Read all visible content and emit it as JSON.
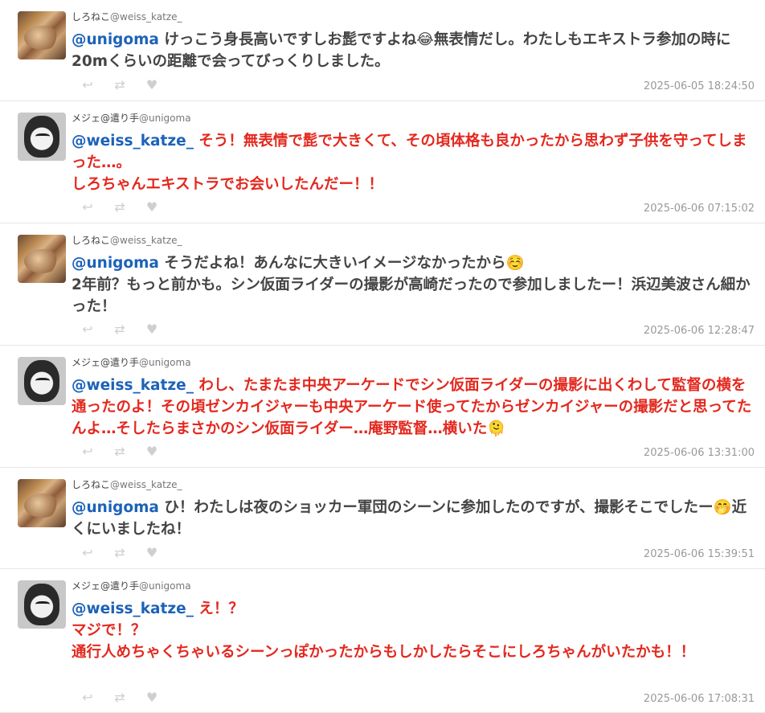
{
  "tweets": [
    {
      "author": "しろねこ",
      "handle": "@weiss_katze_",
      "avatar": "cat-photo-avatar",
      "mention": "@unigoma",
      "text": " けっこう身長高いですしお髭ですよね😂無表情だし。わたしもエキストラ参加の時に20mくらいの距離で会ってびっくりしました。",
      "timestamp": "2025-06-05 18:24:50",
      "color": "#444444"
    },
    {
      "author": "メジェ@遣り手",
      "handle": "@unigoma",
      "avatar": "sketch-face-avatar",
      "mention": "@weiss_katze_",
      "text": " そう！無表情で髭で大きくて、その頃体格も良かったから思わず子供を守ってしまった…。\nしろちゃんエキストラでお会いしたんだー！！",
      "timestamp": "2025-06-06 07:15:02",
      "color": "#e4281e"
    },
    {
      "author": "しろねこ",
      "handle": "@weiss_katze_",
      "avatar": "cat-photo-avatar",
      "mention": "@unigoma",
      "text": " そうだよね！あんなに大きいイメージなかったから☺️\n2年前？もっと前かも。シン仮面ライダーの撮影が高崎だったので参加しましたー！浜辺美波さん細かった！",
      "timestamp": "2025-06-06 12:28:47",
      "color": "#444444"
    },
    {
      "author": "メジェ@遣り手",
      "handle": "@unigoma",
      "avatar": "sketch-face-avatar",
      "mention": "@weiss_katze_",
      "text": " わし、たまたま中央アーケードでシン仮面ライダーの撮影に出くわして監督の横を通ったのよ！その頃ゼンカイジャーも中央アーケード使ってたからゼンカイジャーの撮影だと思ってたんよ…そしたらまさかのシン仮面ライダー…庵野監督…横いた🫠",
      "timestamp": "2025-06-06 13:31:00",
      "color": "#e4281e"
    },
    {
      "author": "しろねこ",
      "handle": "@weiss_katze_",
      "avatar": "cat-photo-avatar",
      "mention": "@unigoma",
      "text": " ひ！わたしは夜のショッカー軍団のシーンに参加したのですが、撮影そこでしたー🤭近くにいましたね！",
      "timestamp": "2025-06-06 15:39:51",
      "color": "#444444"
    },
    {
      "author": "メジェ@遣り手",
      "handle": "@unigoma",
      "avatar": "sketch-face-avatar",
      "mention": "@weiss_katze_",
      "text": " え！？\nマジで！？\n通行人めちゃくちゃいるシーンっぽかったからもしかしたらそこにしろちゃんがいたかも！！",
      "timestamp": "2025-06-06 17:08:31",
      "color": "#e4281e"
    }
  ],
  "icons": {
    "reply": "reply-icon",
    "retweet": "retweet-icon",
    "like": "heart-icon"
  }
}
